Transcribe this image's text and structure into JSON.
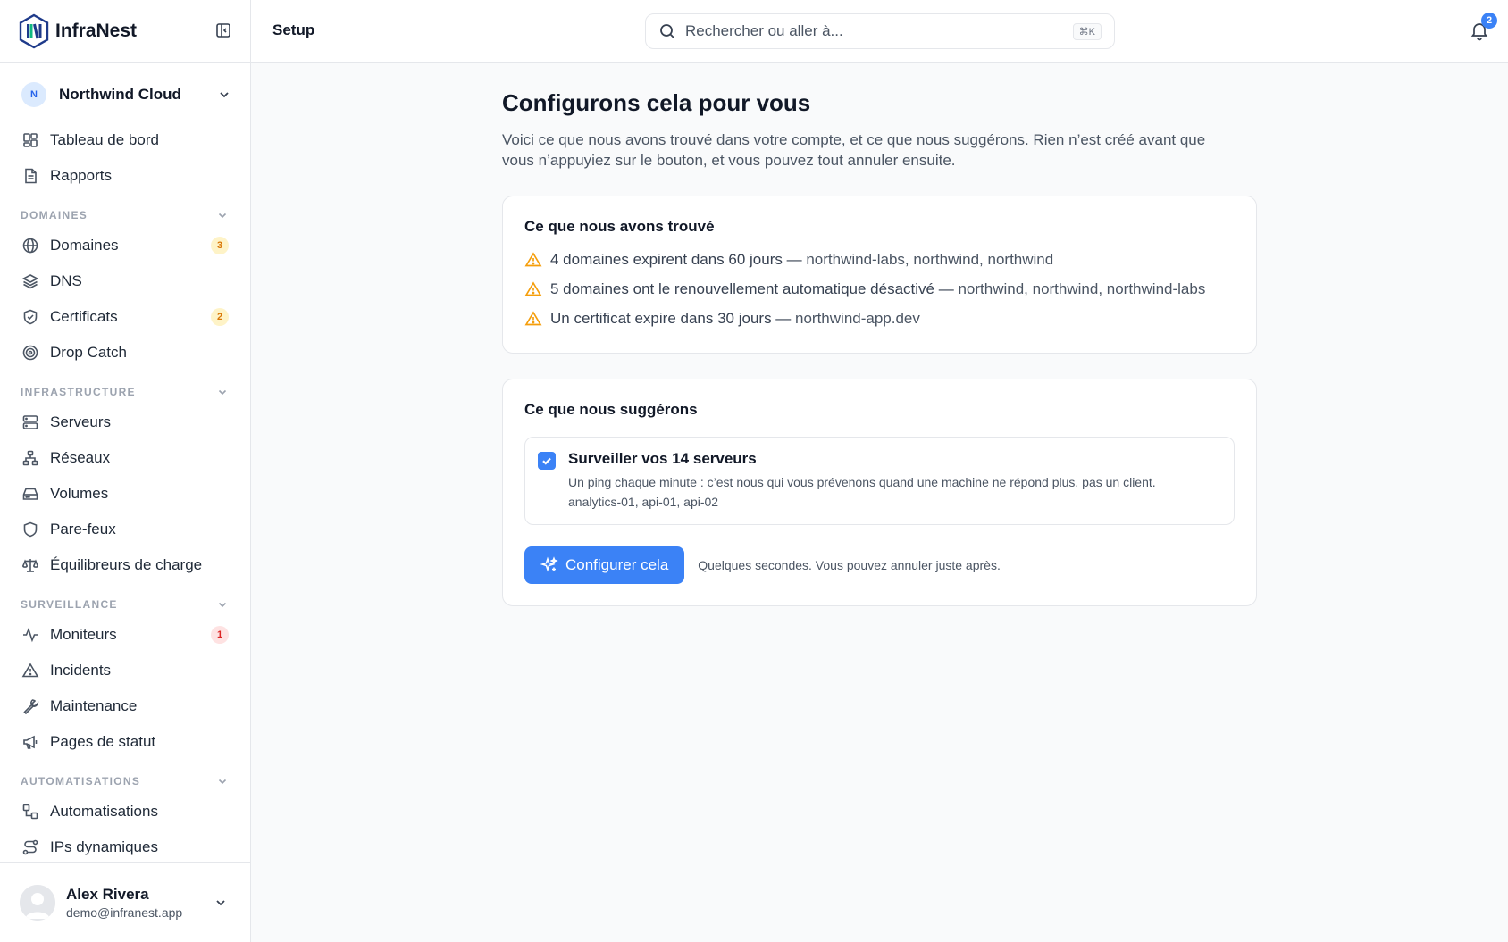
{
  "brand": {
    "name": "InfraNest"
  },
  "workspace": {
    "initial": "N",
    "name": "Northwind Cloud"
  },
  "nav": {
    "dashboard": "Tableau de bord",
    "reports": "Rapports",
    "sections": {
      "domains": "DOMAINES",
      "infrastructure": "INFRASTRUCTURE",
      "monitoring": "SURVEILLANCE",
      "automation": "AUTOMATISATIONS"
    },
    "domains": {
      "label": "Domaines",
      "badge": "3"
    },
    "dns": "DNS",
    "certificates": {
      "label": "Certificats",
      "badge": "2"
    },
    "drop_catch": "Drop Catch",
    "servers": "Serveurs",
    "networks": "Réseaux",
    "volumes": "Volumes",
    "firewalls": "Pare-feux",
    "load_balancers": "Équilibreurs de charge",
    "monitors": {
      "label": "Moniteurs",
      "badge": "1"
    },
    "incidents": "Incidents",
    "maintenance": "Maintenance",
    "status_pages": "Pages de statut",
    "automations": "Automatisations",
    "dynamic_ips": "IPs dynamiques"
  },
  "user": {
    "name": "Alex Rivera",
    "email": "demo@infranest.app"
  },
  "topbar": {
    "page": "Setup",
    "search_placeholder": "Rechercher ou aller à...",
    "shortcut": "⌘K",
    "notifications": "2"
  },
  "main": {
    "title": "Configurons cela pour vous",
    "subtitle": "Voici ce que nous avons trouvé dans votre compte, et ce que nous suggérons. Rien n’est créé avant que vous n’appuyiez sur le bouton, et vous pouvez tout annuler ensuite.",
    "found": {
      "title": "Ce que nous avons trouvé",
      "items": [
        {
          "text": "4 domaines expirent dans 60 jours",
          "detail": "northwind-labs, northwind, northwind"
        },
        {
          "text": "5 domaines ont le renouvellement automatique désactivé",
          "detail": "northwind, northwind, northwind-labs"
        },
        {
          "text": "Un certificat expire dans 30 jours",
          "detail": "northwind-app.dev"
        }
      ]
    },
    "suggest": {
      "title": "Ce que nous suggérons",
      "item_title": "Surveiller vos 14 serveurs",
      "item_desc": "Un ping chaque minute : c’est nous qui vous prévenons quand une machine ne répond plus, pas un client.",
      "item_hosts": "analytics-01, api-01, api-02",
      "button": "Configurer cela",
      "hint": "Quelques secondes. Vous pouvez annuler juste après."
    }
  },
  "colors": {
    "accent": "#3b82f6",
    "warning": "#f59e0b",
    "danger": "#dc2626"
  }
}
